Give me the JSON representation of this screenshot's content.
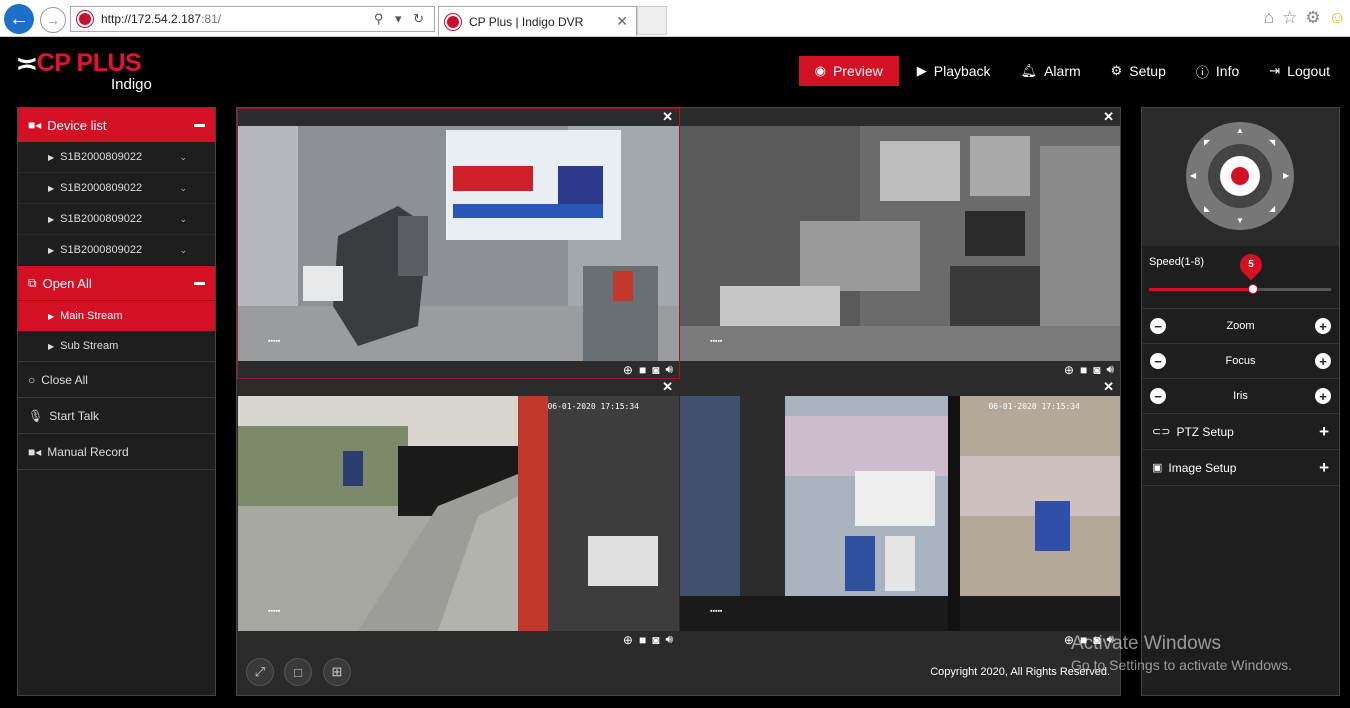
{
  "browser": {
    "url_host": "http://172.54.2.187",
    "url_port": ":81/",
    "tab_title": "CP Plus | Indigo DVR",
    "addr_controls": "⚲ ▾ ↻"
  },
  "brand": {
    "name": "CP PLUS",
    "sub": "Indigo"
  },
  "topnav": {
    "preview": "Preview",
    "playback": "Playback",
    "alarm": "Alarm",
    "setup": "Setup",
    "info": "Info",
    "logout": "Logout"
  },
  "sidebar": {
    "device_list": "Device list",
    "devices": [
      "S1B2000809022",
      "S1B2000809022",
      "S1B2000809022",
      "S1B2000809022"
    ],
    "open_all": "Open All",
    "main_stream": "Main Stream",
    "sub_stream": "Sub Stream",
    "close_all": "Close All",
    "start_talk": "Start Talk",
    "manual_record": "Manual Record"
  },
  "video": {
    "timestamps": [
      "",
      "",
      "06-01-2020 17:15:34",
      "06-01-2020 17:15:34"
    ],
    "copyright": "Copyright 2020, All Rights Reserved."
  },
  "ptz": {
    "speed_label": "Speed(1-8)",
    "speed_value": "5",
    "speed_fraction": 0.57,
    "zoom": "Zoom",
    "focus": "Focus",
    "iris": "Iris",
    "ptz_setup": "PTZ Setup",
    "image_setup": "Image Setup"
  },
  "overlay": {
    "activate_title": "Activate Windows",
    "activate_sub": "Go to Settings to activate Windows."
  },
  "colors": {
    "accent": "#d31024",
    "panel": "#1e1e1e"
  }
}
